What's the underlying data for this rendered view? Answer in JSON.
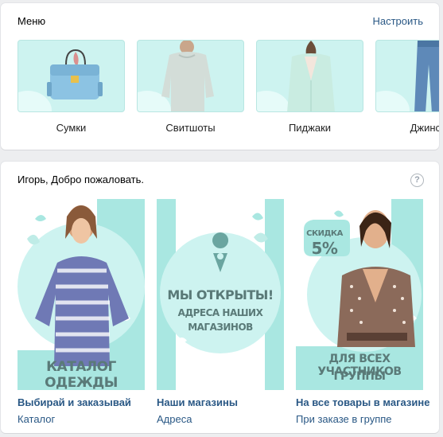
{
  "menu": {
    "title": "Меню",
    "settings_link": "Настроить",
    "items": [
      {
        "label": "Сумки",
        "icon": "bag-image"
      },
      {
        "label": "Свитшоты",
        "icon": "sweatshirt-image"
      },
      {
        "label": "Пиджаки",
        "icon": "jacket-image"
      },
      {
        "label": "Джинсы",
        "icon": "jeans-image"
      }
    ]
  },
  "widget": {
    "greeting": "Игорь, Добро пожаловать.",
    "help_icon": "?",
    "promos": [
      {
        "banner_text": "КАТАЛОГ ОДЕЖДЫ",
        "caption": "Выбирай и заказывай",
        "sub": "Каталог"
      },
      {
        "banner_line1": "МЫ ОТКРЫТЫ!",
        "banner_line2": "АДРЕСА НАШИХ",
        "banner_line3": "МАГАЗИНОВ",
        "caption": "Наши магазины",
        "sub": "Адреса"
      },
      {
        "badge_label": "СКИДКА",
        "badge_value": "5%",
        "banner_line1": "ДЛЯ ВСЕХ УЧАСТНИКОВ",
        "banner_line2": "ГРУППЫ",
        "caption": "На все товары в магазине",
        "sub": "При заказе в группе"
      }
    ]
  },
  "colors": {
    "mint": "#cdf3f0",
    "mint_dark": "#a9e7e1",
    "link": "#2a5885",
    "banner_text": "#5a7a78"
  }
}
